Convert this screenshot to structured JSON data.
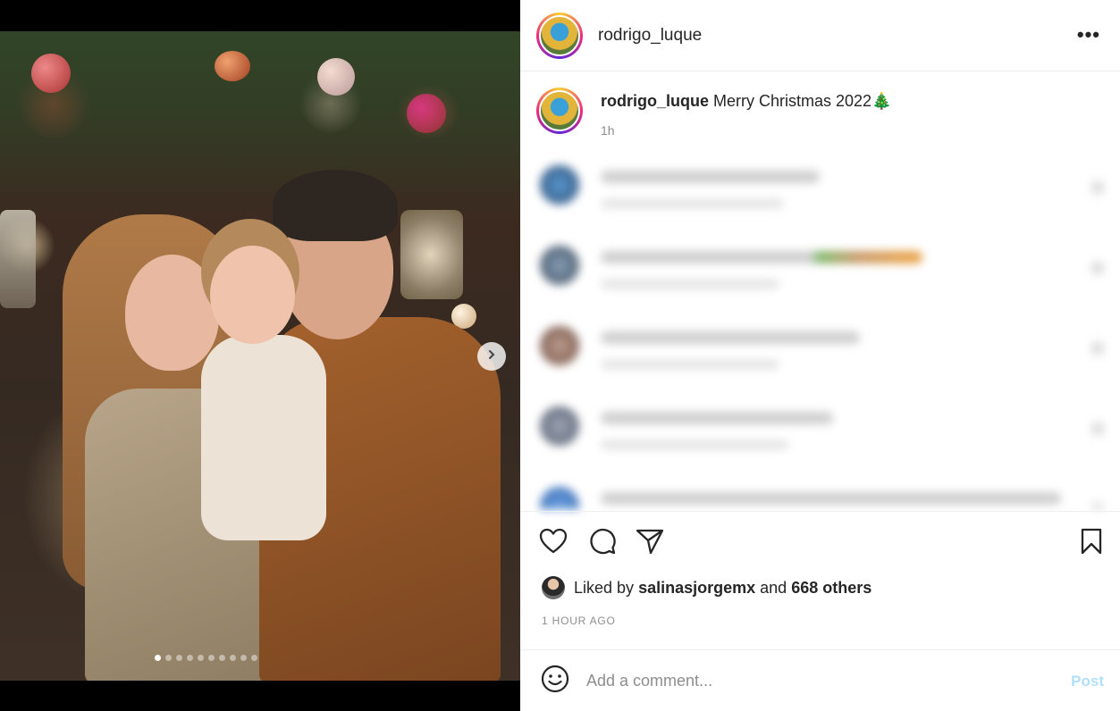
{
  "post": {
    "username": "rodrigo_luque",
    "more_label": "•••",
    "caption_text": "Merry Christmas 2022🎄",
    "caption_time": "1h",
    "carousel": {
      "slides": 10,
      "active_index": 0,
      "next_icon": "chevron-right-icon"
    }
  },
  "likes": {
    "prefix": "Liked by",
    "user": "salinasjorgemx",
    "connector": "and",
    "others": "668 others"
  },
  "timestamp": "1 HOUR AGO",
  "comment_box": {
    "placeholder": "Add a comment...",
    "post_label": "Post"
  },
  "icons": {
    "like": "heart-icon",
    "comment": "comment-bubble-icon",
    "share": "paper-plane-icon",
    "save": "bookmark-icon",
    "emoji": "smiley-icon"
  },
  "colors": {
    "text": "#262626",
    "muted": "#8e8e8e",
    "post_disabled": "#b2dffc",
    "divider": "#efefef"
  }
}
